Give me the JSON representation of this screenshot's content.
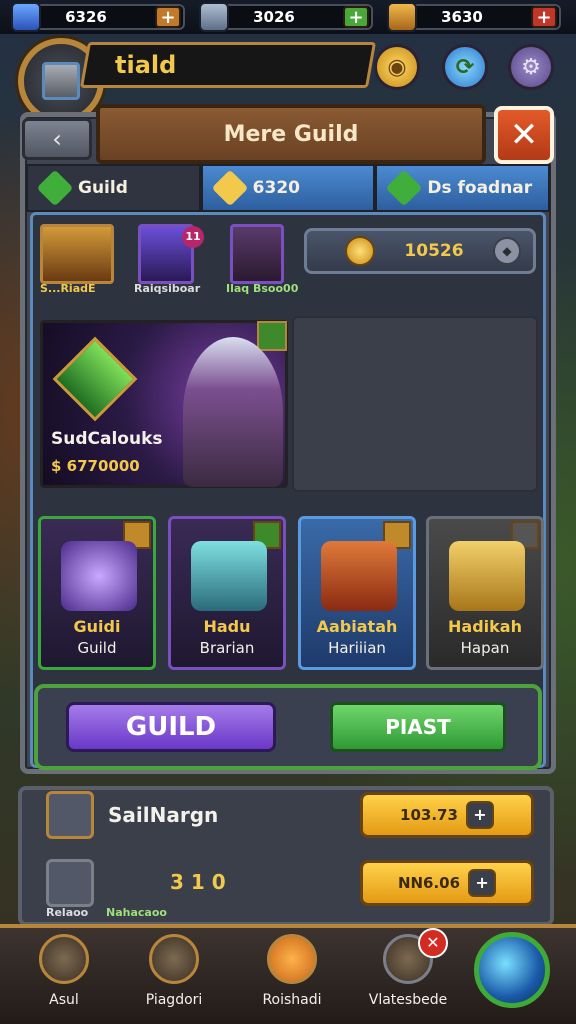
{
  "resources": [
    {
      "value": "6326",
      "plus": "+",
      "color": "#3b6fd4",
      "plus_color": "#c07a2a"
    },
    {
      "value": "3026",
      "plus": "+",
      "color": "#7a8da8",
      "plus_color": "#4aa83a"
    },
    {
      "value": "3630",
      "plus": "+",
      "color": "#c98a2a",
      "plus_color": "#c0362a"
    }
  ],
  "header": {
    "player_name": "tiald"
  },
  "title": "Mere Guild",
  "close_label": "✕",
  "back_label": "‹",
  "tabs": [
    {
      "label": "Guild"
    },
    {
      "label": "6320"
    },
    {
      "label": "Ds foadnar"
    }
  ],
  "top_items": [
    {
      "label": "S...RiadE",
      "badge": ""
    },
    {
      "label": "Raiqsiboar",
      "badge": "11"
    },
    {
      "label": "Ilaq Bsoo00",
      "badge": ""
    }
  ],
  "coins": {
    "value": "10526"
  },
  "featured": {
    "name": "SudCalouks",
    "value": "$ 6770000"
  },
  "cards": [
    {
      "title": "Guidi",
      "subtitle": "Guild",
      "accent": "#3aa83a"
    },
    {
      "title": "Hadu",
      "subtitle": "Brarian",
      "accent": "#7a4fc0"
    },
    {
      "title": "Aabiatah",
      "subtitle": "Hariiian",
      "accent": "#3d7fd0"
    },
    {
      "title": "Hadikah",
      "subtitle": "Hapan",
      "accent": "#6b6f78"
    }
  ],
  "buttons": {
    "guild": "GUILD",
    "past": "PIAST"
  },
  "lower": {
    "row1": {
      "name": "SailNargn",
      "value": "103.73",
      "btn": "+"
    },
    "row2": {
      "value": "NN6.06",
      "btn": "+",
      "num": "3 1 0",
      "sub1": "Relaoo",
      "sub2": "Nahacaoo"
    }
  },
  "nav": [
    {
      "label": "Asul"
    },
    {
      "label": "Piagdori"
    },
    {
      "label": "Roishadi"
    },
    {
      "label": "Vlatesbede",
      "badge": "✕"
    }
  ]
}
